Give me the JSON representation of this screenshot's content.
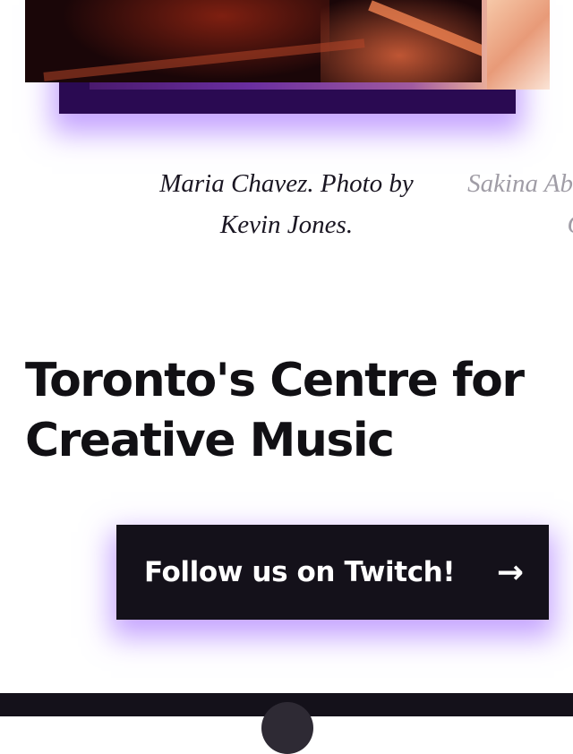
{
  "carousel": {
    "captions": [
      {
        "text": "Maria Chavez. Photo by Kevin Jones."
      },
      {
        "text": "Sakina Abdou. Photo by Gree"
      }
    ]
  },
  "hero": {
    "heading": "Toronto's Centre for Creative Music"
  },
  "cta": {
    "label": "Follow us on Twitch!",
    "arrow": "→"
  },
  "colors": {
    "accent_glow": "#9a5cff",
    "button_bg": "#14111a",
    "heading_text": "#111014",
    "caption_faded": "#a09da6"
  }
}
